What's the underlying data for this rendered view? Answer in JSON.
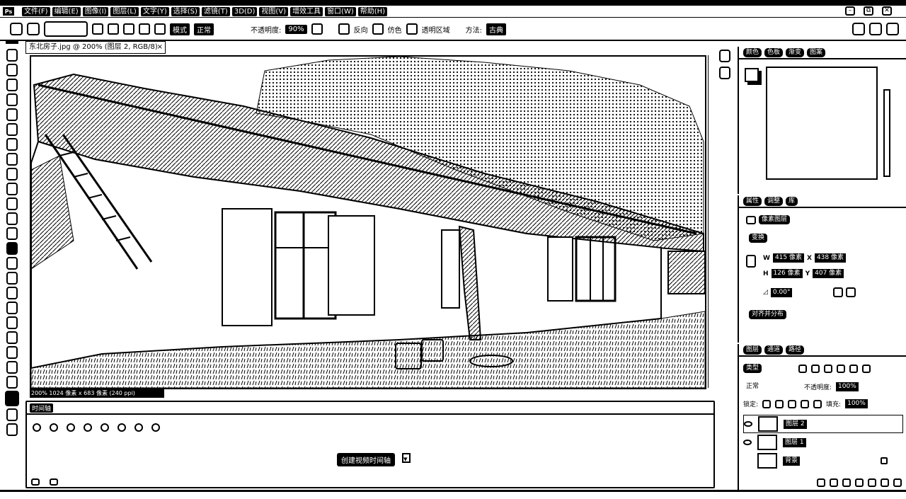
{
  "app": {
    "logo": "Ps",
    "menus": [
      "文件(F)",
      "编辑(E)",
      "图像(I)",
      "图层(L)",
      "文字(Y)",
      "选择(S)",
      "滤镜(T)",
      "3D(D)",
      "视图(V)",
      "增效工具",
      "窗口(W)",
      "帮助(H)"
    ],
    "window_buttons": [
      "–",
      "⧉",
      "✕"
    ]
  },
  "options_bar": {
    "mode_label": "模式",
    "mode_value": "正常",
    "opacity_label": "不透明度:",
    "opacity_value": "90%",
    "reverse_label": "反向",
    "dither_label": "仿色",
    "transparency_label": "透明区域",
    "method_label": "方法:",
    "method_value": "古典"
  },
  "document": {
    "tab_title": "东北房子.jpg @ 200% (图层 2, RGB/8)",
    "tab_close": "×",
    "status_text": "200%   1024 像素 x 683 像素 (240 ppi)"
  },
  "timeline": {
    "title": "时间轴",
    "create_button": "创建视频时间轴",
    "dropdown": "▾"
  },
  "color_panel": {
    "tabs": [
      "颜色",
      "色板",
      "渐变",
      "图案"
    ]
  },
  "properties_panel": {
    "tabs": [
      "属性",
      "调整",
      "库"
    ],
    "section_title": "像素图层",
    "transform_label": "变换",
    "w_label": "W",
    "w_value": "415 像素",
    "x_label": "X",
    "x_value": "438 像素",
    "h_label": "H",
    "h_value": "126 像素",
    "y_label": "Y",
    "y_value": "407 像素",
    "angle_value": "0.00°",
    "align_label": "对齐并分布"
  },
  "layers_panel": {
    "tabs": [
      "图层",
      "通道",
      "路径"
    ],
    "filter_label": "类型",
    "blend_mode": "正常",
    "opacity_label": "不透明度:",
    "opacity_value": "100%",
    "lock_label": "锁定:",
    "fill_label": "填充:",
    "fill_value": "100%",
    "layers": [
      {
        "name": "图层 2"
      },
      {
        "name": "图层 1"
      },
      {
        "name": "背景"
      }
    ]
  }
}
